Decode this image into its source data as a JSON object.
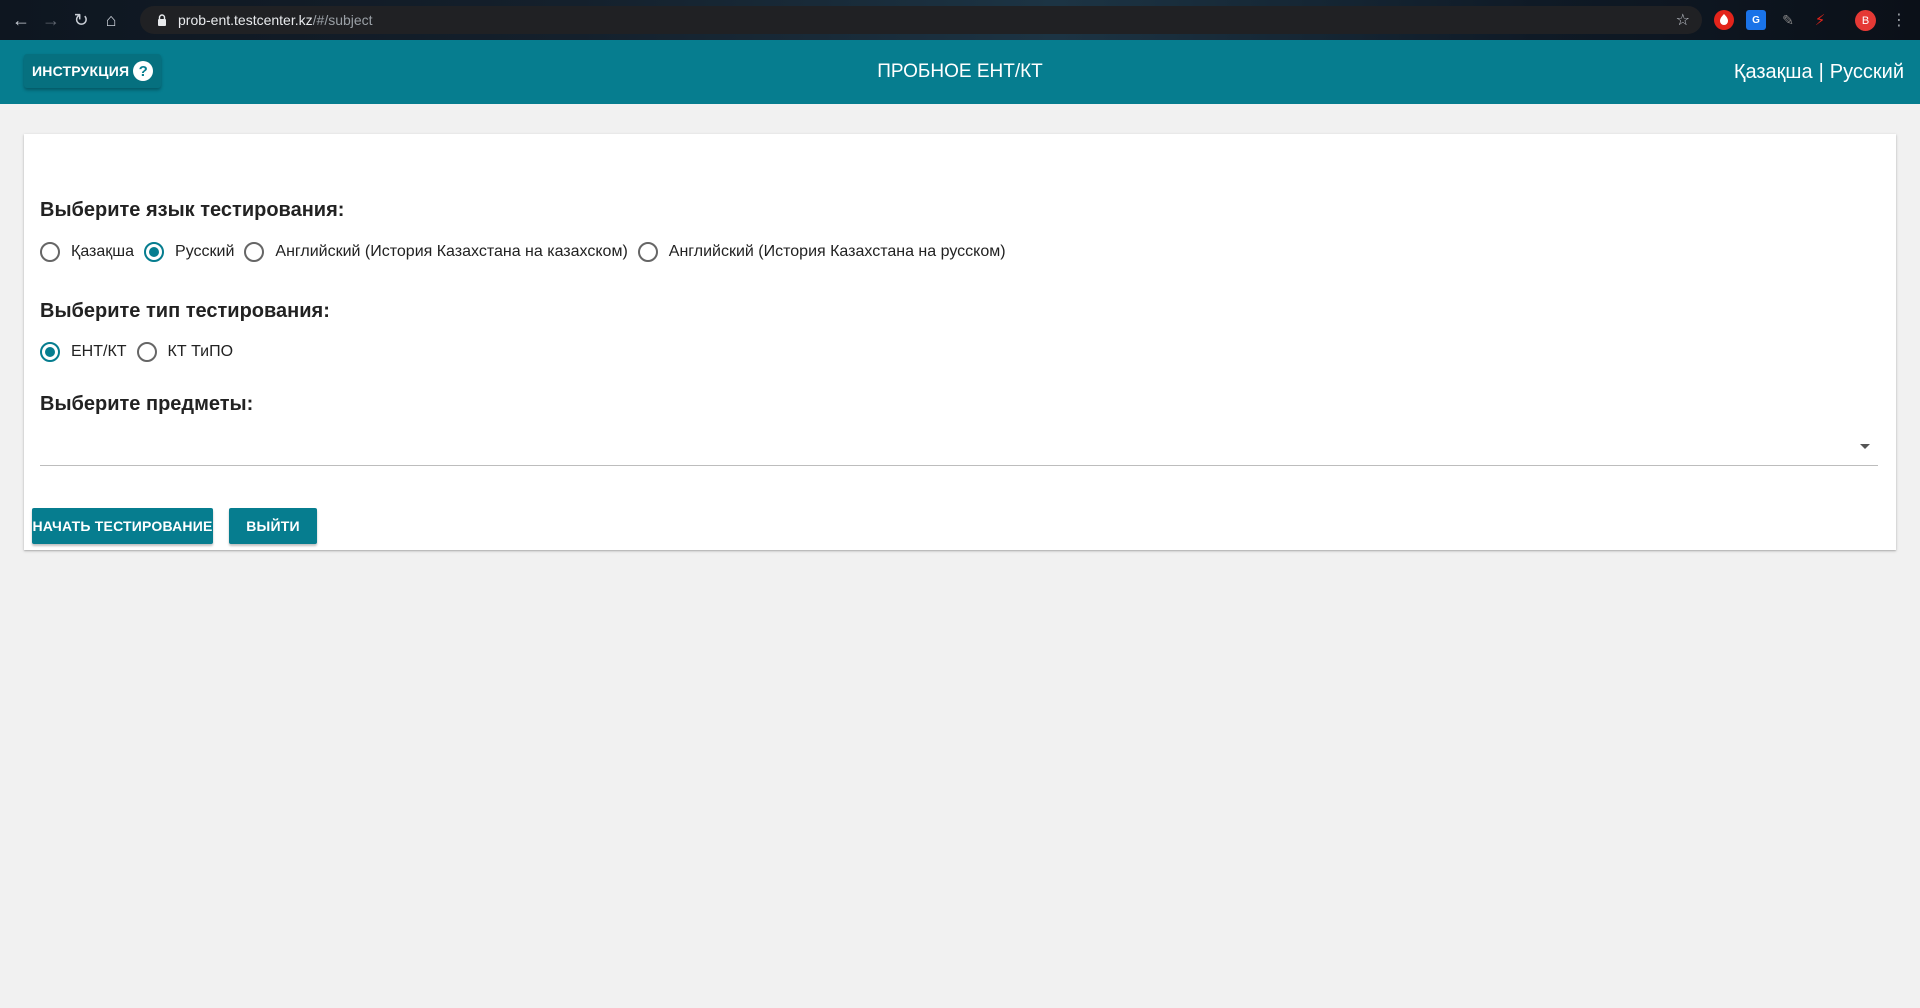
{
  "browser": {
    "nav": {
      "back_icon": "←",
      "forward_icon": "→",
      "reload_icon": "↻",
      "home_icon": "⌂"
    },
    "url_host": "prob-ent.testcenter.kz",
    "url_path": "/#/subject",
    "star_icon": "☆",
    "extensions": {
      "ext_blue_text": "G",
      "pen_icon": "✎",
      "pdf_icon": "⚡"
    },
    "avatar_initial": "B",
    "menu_icon": "⋮"
  },
  "header": {
    "instruction_label": "ИНСТРУКЦИЯ",
    "help_icon": "?",
    "title": "ПРОБНОЕ ЕНТ/КТ",
    "lang_kazakh": "Қазақша",
    "lang_separator": "|",
    "lang_russian": "Русский",
    "color": "#067d8f"
  },
  "form": {
    "language_section": {
      "title": "Выберите язык тестирования:",
      "options": [
        {
          "label": "Қазақша",
          "checked": false
        },
        {
          "label": "Русский",
          "checked": true
        },
        {
          "label": "Английский (История Казахстана на казахском)",
          "checked": false
        },
        {
          "label": "Английский (История Казахстана на русском)",
          "checked": false
        }
      ]
    },
    "type_section": {
      "title": "Выберите тип тестирования:",
      "options": [
        {
          "label": "ЕНТ/КТ",
          "checked": true
        },
        {
          "label": "КТ ТиПО",
          "checked": false
        }
      ]
    },
    "subjects_section": {
      "title": "Выберите предметы:",
      "selected_value": ""
    },
    "buttons": {
      "start": "НАЧАТЬ ТЕСТИРОВАНИЕ",
      "exit": "ВЫЙТИ"
    }
  }
}
